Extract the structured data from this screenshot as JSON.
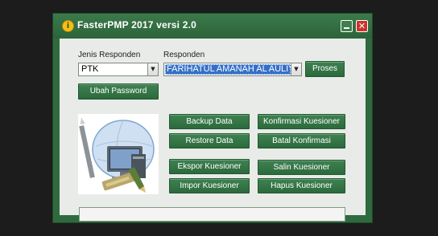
{
  "window": {
    "title": "FasterPMP 2017 versi 2.0"
  },
  "form": {
    "jenis_label": "Jenis Responden",
    "jenis_value": "PTK",
    "responden_label": "Responden",
    "responden_value": "FARIHATUL AMANAH AL AULIY",
    "proses_button": "Proses",
    "ubah_password_button": "Ubah Password"
  },
  "buttons": {
    "backup": "Backup Data",
    "restore": "Restore Data",
    "ekspor": "Ekspor Kuesioner",
    "impor": "Impor Kuesioner",
    "konfirmasi": "Konfirmasi Kuesioner",
    "batal": "Batal Konfirmasi",
    "salin": "Salin Kuesioner",
    "hapus": "Hapus Kuesioner"
  },
  "progress": {
    "value_fraction": 0
  },
  "colors": {
    "accent": "#2f6a3e",
    "close": "#c8352c"
  }
}
